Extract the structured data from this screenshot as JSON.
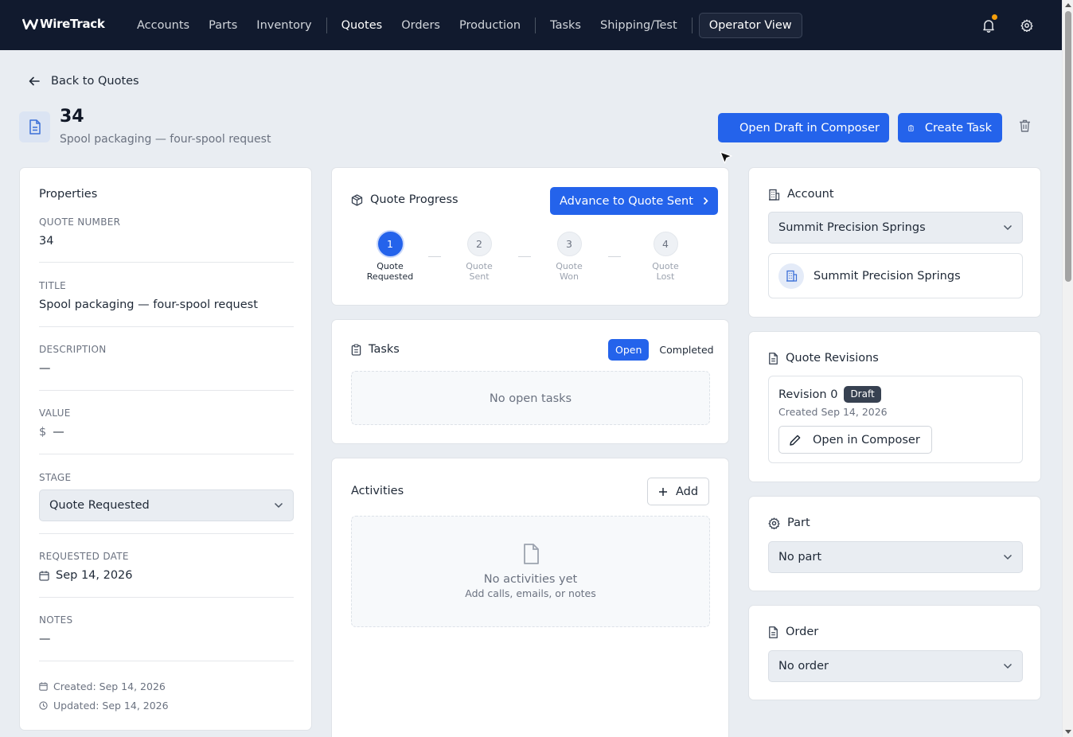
{
  "brand": {
    "name": "WireTrack"
  },
  "nav": {
    "items": [
      "Accounts",
      "Parts",
      "Inventory",
      "Quotes",
      "Orders",
      "Production",
      "Tasks",
      "Shipping/Test"
    ],
    "operator_view": "Operator View"
  },
  "header": {
    "back_label": "Back to Quotes",
    "title": "34",
    "subtitle": "Spool packaging — four-spool request",
    "open_draft_label": "Open Draft in Composer",
    "create_task_label": "Create Task"
  },
  "properties": {
    "title": "Properties",
    "quote_number_label": "QUOTE NUMBER",
    "quote_number": "34",
    "title_label": "TITLE",
    "title_value": "Spool packaging — four-spool request",
    "description_label": "DESCRIPTION",
    "description_value": "—",
    "value_label": "VALUE",
    "value_currency": "$",
    "value_value": "—",
    "stage_label": "STAGE",
    "stage_value": "Quote Requested",
    "requested_date_label": "REQUESTED DATE",
    "requested_date": "Sep 14, 2026",
    "notes_label": "NOTES",
    "notes_value": "—",
    "created": "Created: Sep 14, 2026",
    "updated": "Updated: Sep 14, 2026"
  },
  "progress": {
    "title": "Quote Progress",
    "advance_label": "Advance to Quote Sent",
    "steps": [
      {
        "num": "1",
        "line1": "Quote",
        "line2": "Requested"
      },
      {
        "num": "2",
        "line1": "Quote",
        "line2": "Sent"
      },
      {
        "num": "3",
        "line1": "Quote",
        "line2": "Won"
      },
      {
        "num": "4",
        "line1": "Quote",
        "line2": "Lost"
      }
    ]
  },
  "tasks": {
    "title": "Tasks",
    "tab_open": "Open",
    "tab_completed": "Completed",
    "empty_text": "No open tasks"
  },
  "activities": {
    "title": "Activities",
    "add_label": "Add",
    "empty_title": "No activities yet",
    "empty_sub": "Add calls, emails, or notes"
  },
  "account": {
    "title": "Account",
    "selected": "Summit Precision Springs",
    "card_name": "Summit Precision Springs"
  },
  "revisions": {
    "title": "Quote Revisions",
    "revision_label": "Revision 0",
    "badge": "Draft",
    "created": "Created Sep 14, 2026",
    "open_label": "Open in Composer"
  },
  "part": {
    "title": "Part",
    "selected": "No part"
  },
  "order": {
    "title": "Order",
    "selected": "No order"
  },
  "colors": {
    "primary": "#2463eb",
    "nav_bg": "#111a2e",
    "page_bg": "#e9edf2",
    "notification_dot": "#f59e0b"
  }
}
